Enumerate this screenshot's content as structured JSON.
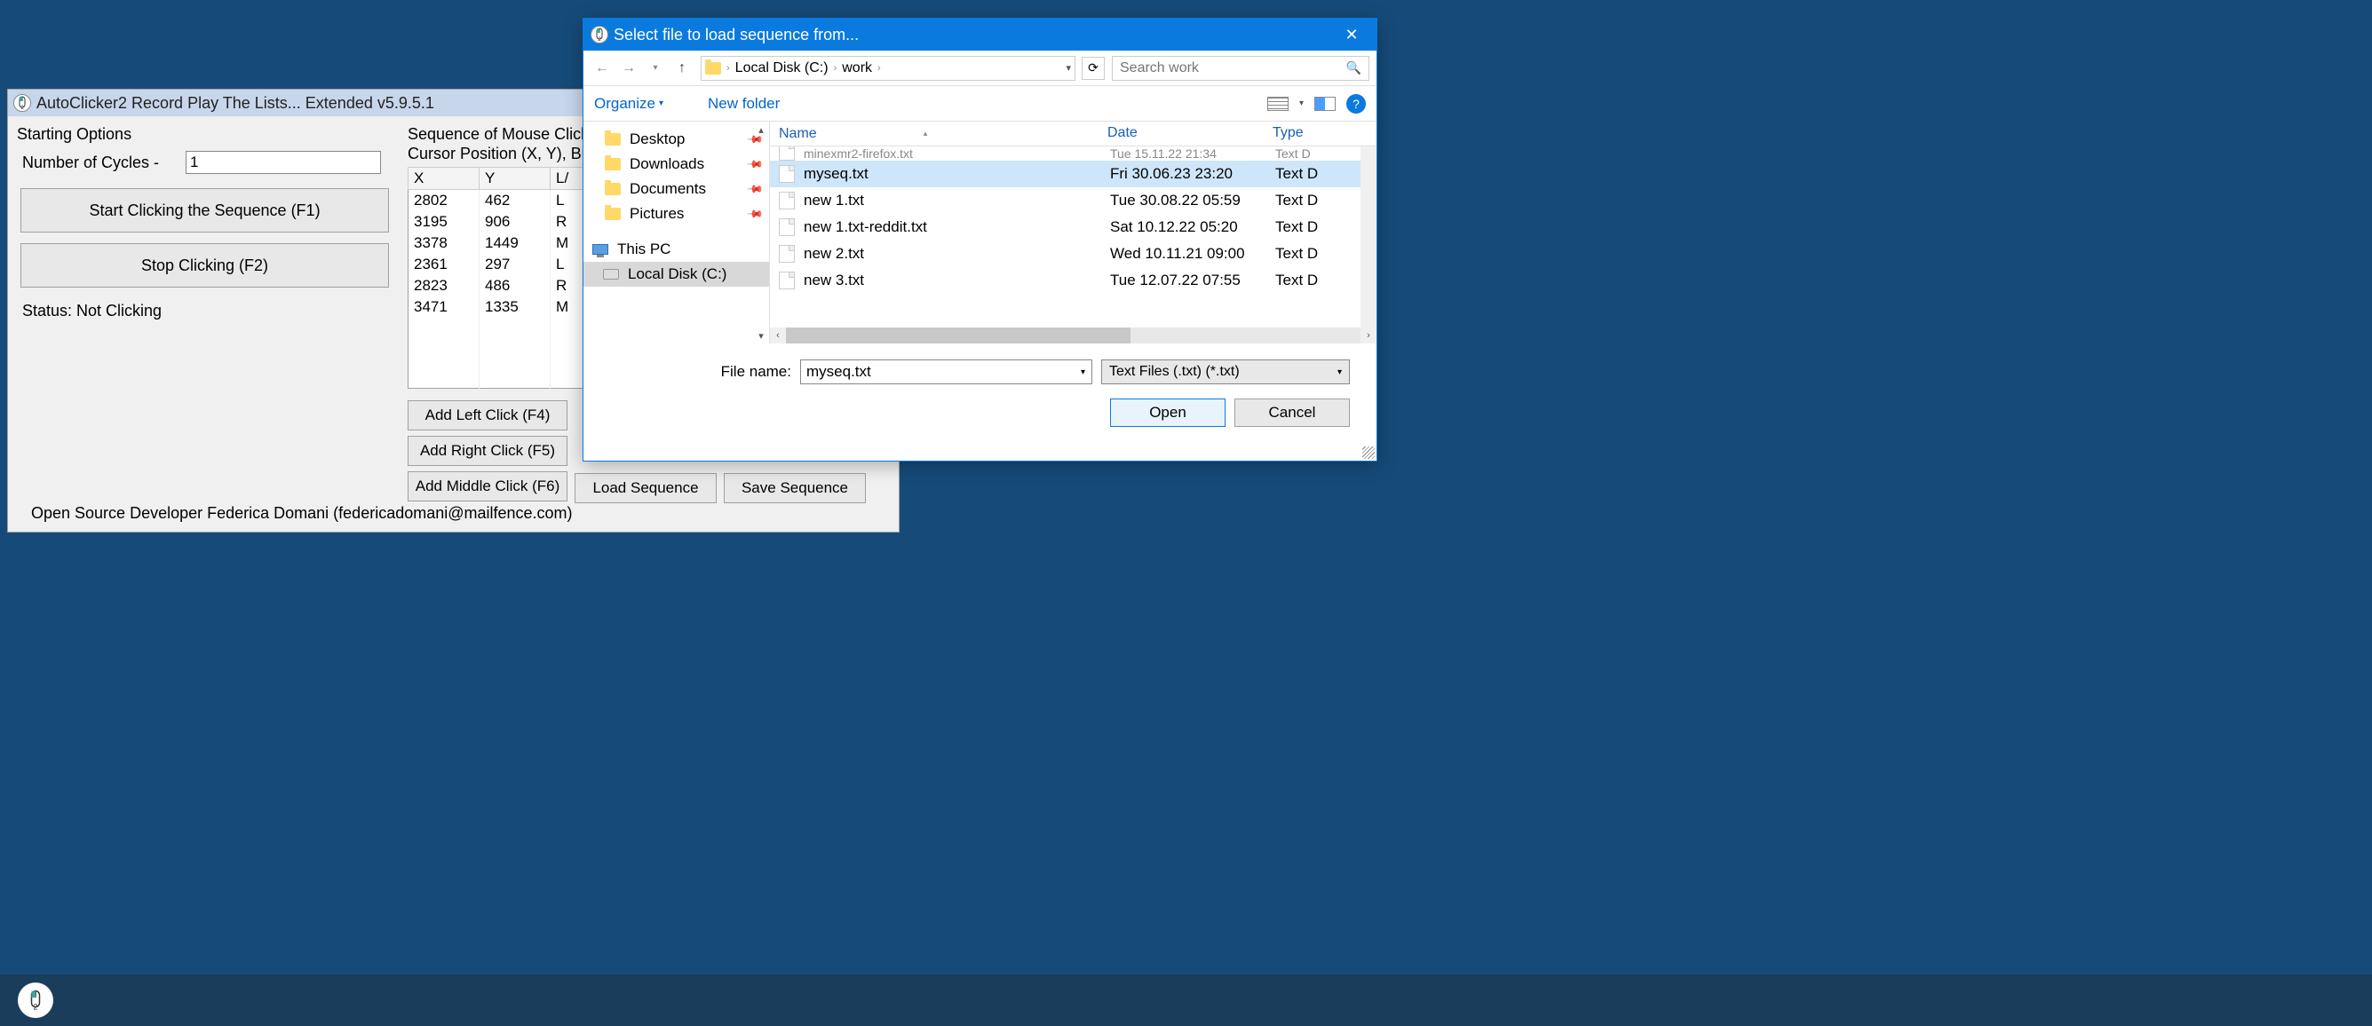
{
  "main": {
    "title": "AutoClicker2 Record Play The Lists... Extended v5.9.5.1",
    "starting_options": "Starting Options",
    "cycles_label": "Number of Cycles -",
    "cycles_value": "1",
    "start_btn": "Start Clicking the Sequence (F1)",
    "stop_btn": "Stop Clicking (F2)",
    "status": "Status: Not Clicking",
    "seq_header_1": "Sequence of Mouse Click",
    "seq_header_2": "Cursor Position (X, Y), Bu",
    "cols": {
      "x": "X",
      "y": "Y",
      "l": "L/"
    },
    "rows": [
      {
        "x": "2802",
        "y": "462",
        "l": "L"
      },
      {
        "x": "3195",
        "y": "906",
        "l": "R"
      },
      {
        "x": "3378",
        "y": "1449",
        "l": "M"
      },
      {
        "x": "2361",
        "y": "297",
        "l": "L"
      },
      {
        "x": "2823",
        "y": "486",
        "l": "R"
      },
      {
        "x": "3471",
        "y": "1335",
        "l": "M"
      }
    ],
    "add_left": "Add Left Click (F4)",
    "add_right": "Add Right Click (F5)",
    "add_middle": "Add Middle Click (F6)",
    "load_seq": "Load Sequence",
    "save_seq": "Save Sequence",
    "footer": "Open Source Developer Federica Domani (federicadomani@mailfence.com)"
  },
  "dialog": {
    "title": "Select file to load sequence from...",
    "breadcrumb": {
      "disk": "Local Disk (C:)",
      "folder": "work"
    },
    "search_placeholder": "Search work",
    "organize": "Organize",
    "new_folder": "New folder",
    "nav": {
      "desktop": "Desktop",
      "downloads": "Downloads",
      "documents": "Documents",
      "pictures": "Pictures",
      "thispc": "This PC",
      "localdisk": "Local Disk (C:)"
    },
    "cols": {
      "name": "Name",
      "date": "Date",
      "type": "Type"
    },
    "files": [
      {
        "name": "myseq.txt",
        "date": "Fri 30.06.23 23:20",
        "type": "Text D",
        "selected": true
      },
      {
        "name": "new 1.txt",
        "date": "Tue 30.08.22 05:59",
        "type": "Text D",
        "selected": false
      },
      {
        "name": "new 1.txt-reddit.txt",
        "date": "Sat 10.12.22 05:20",
        "type": "Text D",
        "selected": false
      },
      {
        "name": "new 2.txt",
        "date": "Wed 10.11.21 09:00",
        "type": "Text D",
        "selected": false
      },
      {
        "name": "new 3.txt",
        "date": "Tue 12.07.22 07:55",
        "type": "Text D",
        "selected": false
      }
    ],
    "partial_file": "minexmr2-firefox.txt",
    "partial_date": "Tue 15.11.22 21:34",
    "partial_type": "Text D",
    "filename_label": "File name:",
    "filename_value": "myseq.txt",
    "filetype": "Text Files (.txt) (*.txt)",
    "open": "Open",
    "cancel": "Cancel"
  }
}
